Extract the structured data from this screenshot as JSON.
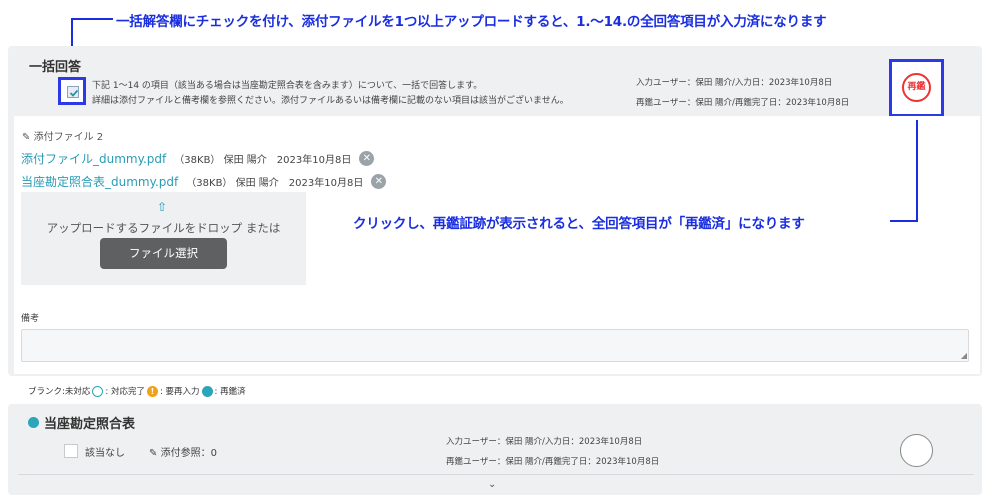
{
  "annotations": {
    "top": "一括解答欄にチェックを付け、添付ファイルを1つ以上アップロードすると、1.〜14.の全回答項目が入力済になります",
    "mid": "クリックし、再鑑証跡が表示されると、全回答項目が「再鑑済」になります"
  },
  "bulk": {
    "title": "一括回答",
    "desc1": "下記 1～14 の項目（該当ある場合は当座勘定照合表を含みます）について、一括で回答します。",
    "desc2": "詳細は添付ファイルと備考欄を参照ください。添付ファイルあるいは備考欄に記載のない項目は該当がございません。",
    "input_meta": "入力ユーザー：保田 陽介/入力日：2023年10月8日",
    "review_meta": "再鑑ユーザー：保田 陽介/再鑑完了日：2023年10月8日",
    "stamp": "再鑑",
    "attachment_header": "添付ファイル 2",
    "files": [
      {
        "name": "添付ファイル_dummy.pdf",
        "meta": "（38KB） 保田 陽介　2023年10月8日"
      },
      {
        "name": "当座勘定照合表_dummy.pdf",
        "meta": "（38KB） 保田 陽介　2023年10月8日"
      }
    ],
    "drop_text": "アップロードするファイルをドロップ または",
    "file_button": "ファイル選択",
    "memo_label": "備考"
  },
  "legend": {
    "blank": "ブランク:未対応",
    "ok": ": 対応完了",
    "warn": ": 要再入力",
    "done": ": 再鑑済"
  },
  "section2": {
    "title": "当座勘定照合表",
    "not_applicable": "該当なし",
    "attach_ref": "添付参照：0",
    "input_meta": "入力ユーザー：保田 陽介/入力日：2023年10月8日",
    "review_meta": "再鑑ユーザー：保田 陽介/再鑑完了日：2023年10月8日"
  },
  "colors": {
    "accent": "#2a9bb5",
    "annotation": "#1a2ee0",
    "stamp": "#e33333",
    "warn": "#f0a11a"
  }
}
